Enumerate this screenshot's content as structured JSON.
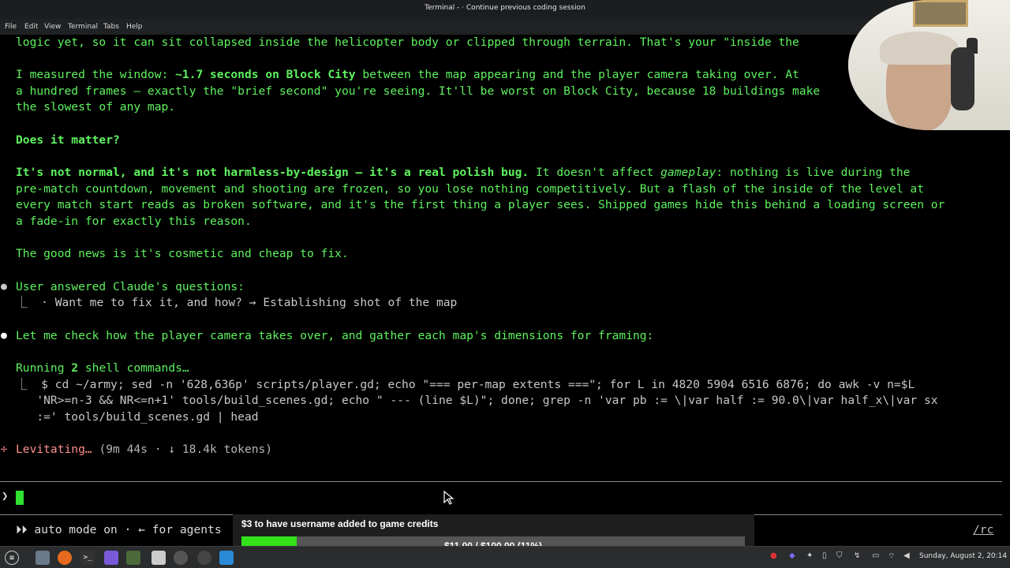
{
  "window": {
    "title": "Terminal - · Continue previous coding session"
  },
  "menu": [
    "File",
    "Edit",
    "View",
    "Terminal",
    "Tabs",
    "Help"
  ],
  "terminal": {
    "l1": "logic yet, so it can sit collapsed inside the helicopter body or clipped through terrain. That's your \"inside the",
    "l2a": "I measured the window: ",
    "l2b": "~1.7 seconds on Block City",
    "l2c": " between the map appearing and the player camera taking over. At",
    "l3": "a hundred frames — exactly the \"brief second\" you're seeing. It'll be worst on Block City, because 18 buildings make",
    "l4": "the slowest of any map.",
    "h1": "Does it matter?",
    "p1a": "It's not normal, and it's not harmless-by-design — it's a real polish bug.",
    "p1b": " It doesn't affect ",
    "p1c": "gameplay",
    "p1d": ": nothing is live during the",
    "p2": "pre-match countdown, movement and shooting are frozen, so you lose nothing competitively. But a flash of the inside of the level at",
    "p3": "every match start reads as broken software, and it's the first thing a player sees. Shipped games hide this behind a loading screen or",
    "p4": "a fade-in for exactly this reason.",
    "p5": "The good news is it's cosmetic and cheap to fix.",
    "q1": "User answered Claude's questions:",
    "q2": "⎿  · Want me to fix it, and how? → Establishing shot of the map",
    "a1": "Let me check how the player camera takes over, and gather each map's dimensions for framing:",
    "r1a": "Running ",
    "r1b": "2",
    "r1c": " shell commands…",
    "c1": "⎿  $ cd ~/army; sed -n '628,636p' scripts/player.gd; echo \"=== per-map extents ===\"; for L in 4820 5904 6516 6876; do awk -v n=$L",
    "c2": "   'NR>=n-3 && NR<=n+1' tools/build_scenes.gd; echo \" --- (line $L)\"; done; grep -n 'var pb := \\|var half := 90.0\\|var half_x\\|var sx",
    "c3": "   :=' tools/build_scenes.gd | head",
    "lev1": "Levitating…",
    "lev2": " (9m 44s · ↓ 18.4k tokens)",
    "prompt": "❯",
    "status": "⏵⏵ auto mode on · ← for agents",
    "rc": "/rc"
  },
  "donation": {
    "label": "$3 to have username added to game credits",
    "amount": "$11.00 / $100.00 (11%)",
    "progress": 0.11
  },
  "taskbar": {
    "clock": "Sunday, August  2, 20:14"
  },
  "colors": {
    "terminal_text": "#5ef25e",
    "progress_fill": "#34e21a"
  }
}
